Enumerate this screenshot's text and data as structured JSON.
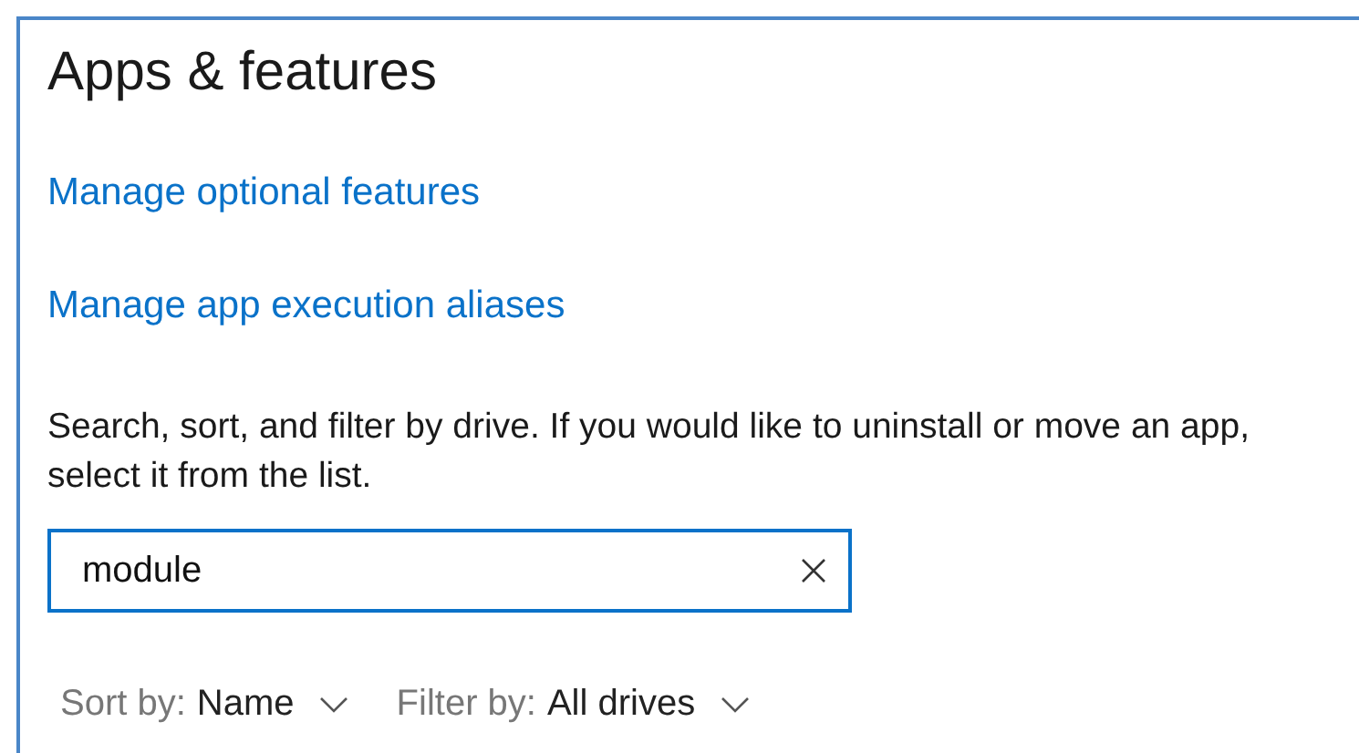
{
  "title": "Apps & features",
  "links": [
    "Manage optional features",
    "Manage app execution aliases"
  ],
  "description": "Search, sort, and filter by drive. If you would like to uninstall or move an app, select it from the list.",
  "search": {
    "value": "module"
  },
  "dropdowns": [
    {
      "label": "Sort by:",
      "value": "Name"
    },
    {
      "label": "Filter by:",
      "value": "All drives"
    }
  ]
}
